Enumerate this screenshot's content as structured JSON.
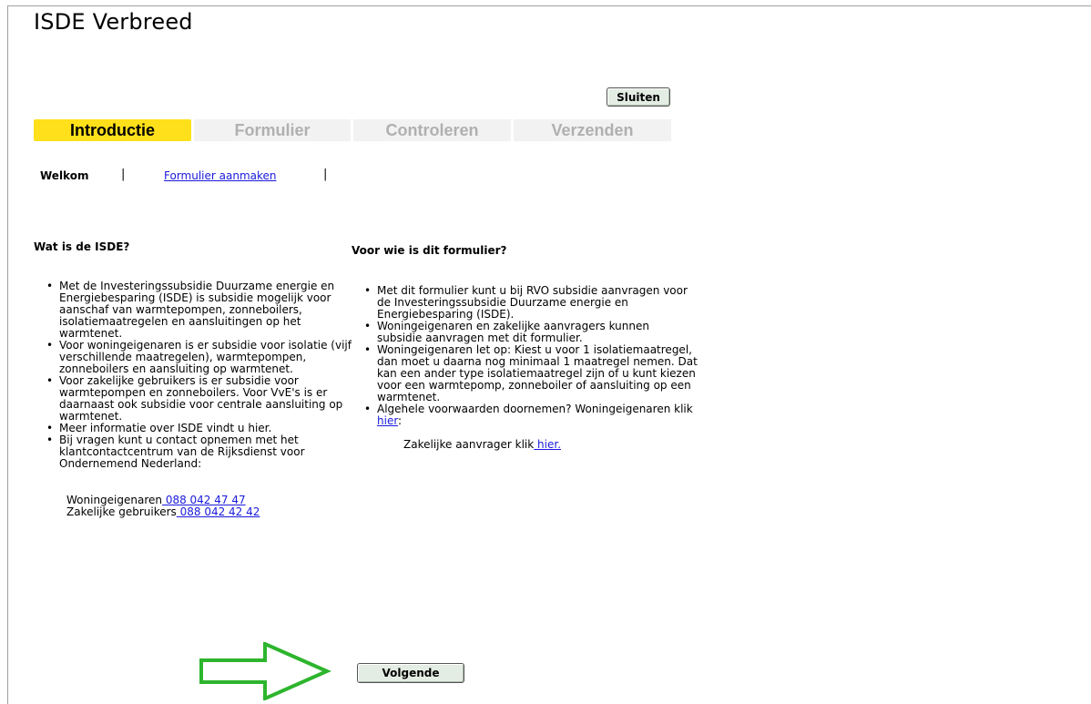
{
  "app": {
    "title": "ISDE Verbreed"
  },
  "header": {
    "close_label": "Sluiten"
  },
  "steps": [
    {
      "label": "Introductie",
      "state": "active"
    },
    {
      "label": "Formulier",
      "state": "inactive"
    },
    {
      "label": "Controleren",
      "state": "inactive"
    },
    {
      "label": "Verzenden",
      "state": "inactive"
    }
  ],
  "subnav": {
    "current": "Welkom",
    "separator": "|",
    "link": "Formulier aanmaken"
  },
  "left": {
    "heading": "Wat is de ISDE?",
    "bullets": [
      "Met de Investeringssubsidie Duurzame energie en Energiebesparing (ISDE) is subsidie mogelijk voor aanschaf van warmtepompen, zonneboilers, isolatiemaatregelen en aansluitingen op het warmtenet.",
      "Voor woningeigenaren is er subsidie voor  isolatie (vijf verschillende maatregelen), warmtepompen, zonneboilers en aansluiting op warmtenet.",
      "Voor zakelijke gebruikers is er subsidie voor warmtepompen en zonneboilers. Voor VvE's is er daarnaast ook subsidie voor centrale aansluiting op warmtenet.",
      "Meer informatie over ISDE vindt u hier.",
      "Bij vragen kunt u contact opnemen met het klantcontactcentrum van de Rijksdienst voor Ondernemend Nederland:"
    ],
    "contacts": [
      {
        "label": "Woningeigenaren",
        "phone": " 088 042 47 47"
      },
      {
        "label": "Zakelijke gebruikers",
        "phone": " 088 042 42 42"
      }
    ]
  },
  "right": {
    "heading": "Voor wie is dit formulier?",
    "bullets": [
      "Met dit formulier kunt u bij RVO subsidie aanvragen voor de Investeringssubsidie Duurzame energie en Energiebesparing (ISDE).",
      "Woningeigenaren en zakelijke aanvragers kunnen subsidie aanvragen met dit formulier.",
      "Woningeigenaren let op: Kiest u voor 1 isolatiemaatregel, dan moet u daarna nog minimaal 1 maatregel nemen. Dat kan een ander type isolatiemaatregel zijn of u kunt kiezen voor een warmtepomp, zonneboiler of aansluiting op een warmtenet."
    ],
    "last_bullet": {
      "text": "Algehele voorwaarden doornemen? Woningeigenaren klik",
      "link": " hier",
      "suffix": ":"
    },
    "zakelijk": {
      "text": "Zakelijke aanvrager klik",
      "link": " hier."
    }
  },
  "footer": {
    "next_label": "Volgende"
  },
  "colors": {
    "active_step": "#ffe01a",
    "inactive_step": "#f2f2f2",
    "inactive_text": "#b0b0b0",
    "button_bg": "#e4ede4",
    "link": "#1a1adc",
    "arrow": "#2db52d"
  },
  "icons": {
    "bullet": "•",
    "arrow": "right-arrow-outline-icon"
  }
}
